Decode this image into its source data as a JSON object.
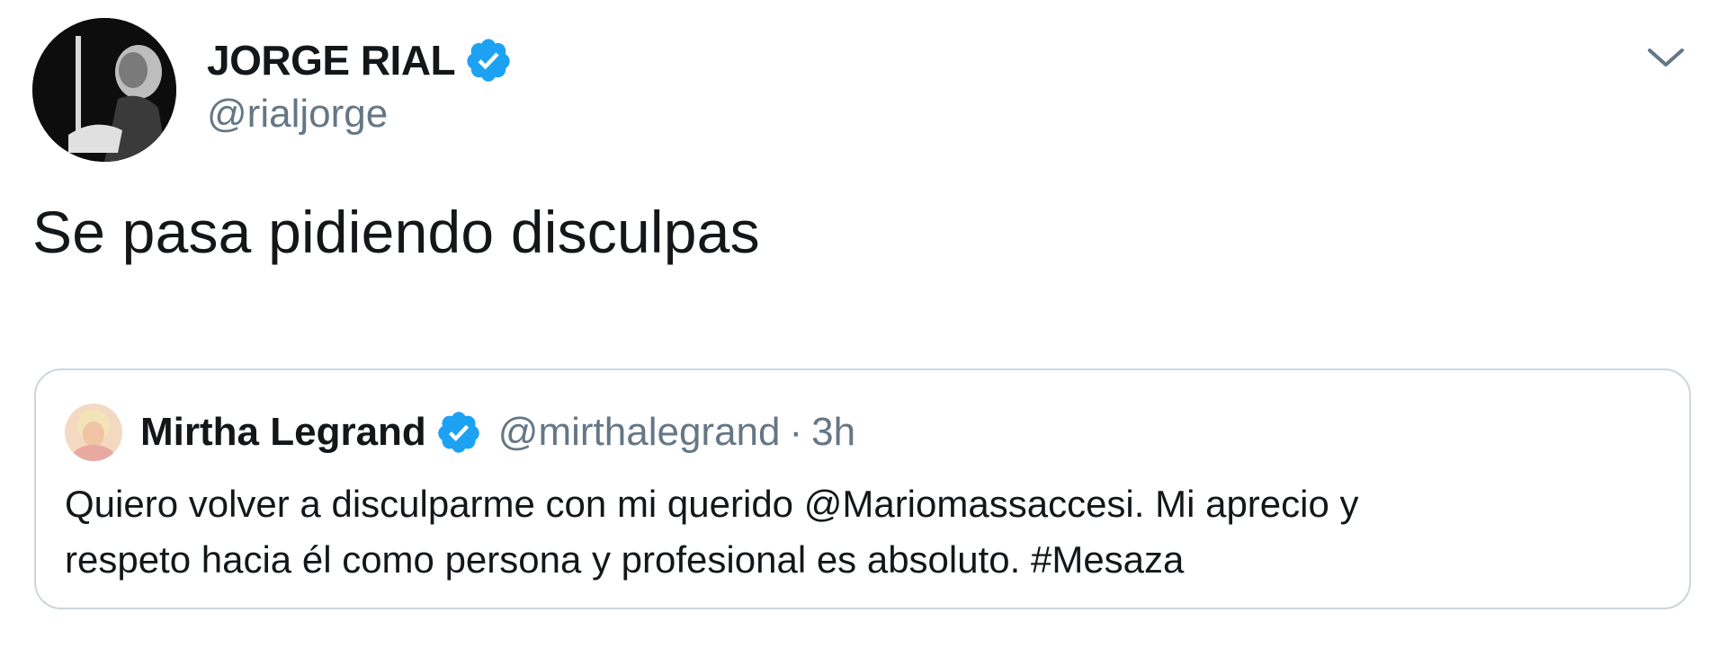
{
  "tweet": {
    "author": {
      "display_name": "JORGE RIAL",
      "handle": "@rialjorge",
      "verified": true,
      "avatar_icon": "avatar-photo"
    },
    "text": "Se pasa pidiendo disculpas",
    "menu_icon": "chevron-down-icon"
  },
  "quoted_tweet": {
    "author": {
      "display_name": "Mirtha Legrand",
      "handle": "@mirthalegrand",
      "verified": true
    },
    "separator": "·",
    "time": "3h",
    "text_line1": "Quiero volver a disculparme con mi querido @Mariomassaccesi. Mi aprecio y",
    "text_line2": "respeto hacia él como persona y profesional es absoluto. #Mesaza"
  },
  "colors": {
    "verified_blue": "#1da1f2",
    "secondary_text": "#657786",
    "border": "#ccd6dd"
  }
}
